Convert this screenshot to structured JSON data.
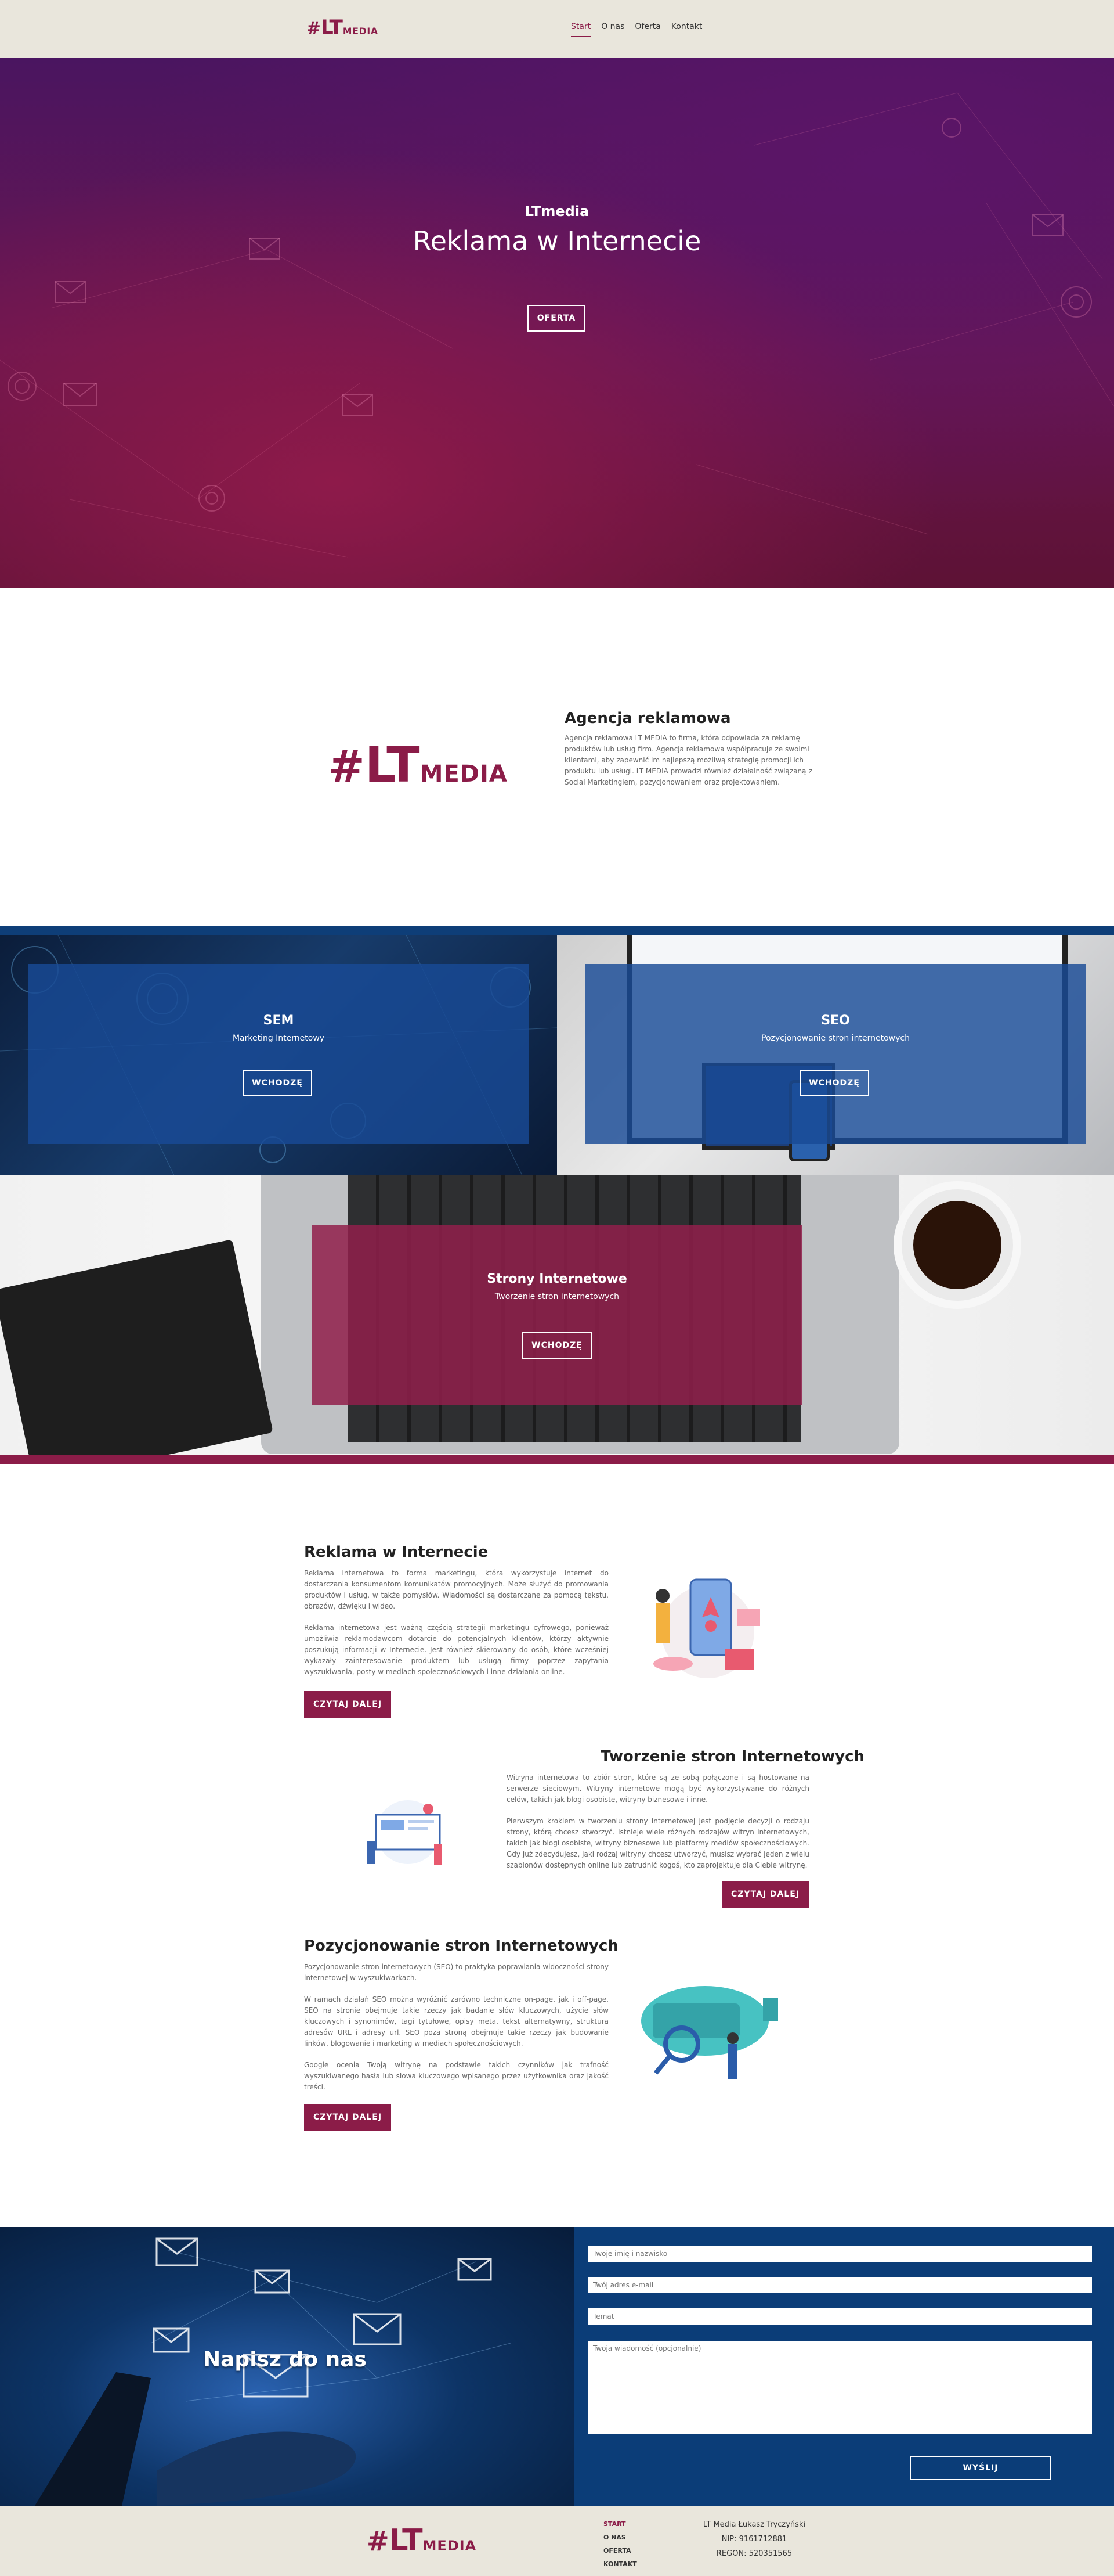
{
  "header": {
    "logo": {
      "hash": "#",
      "lt": "LT",
      "media": "MEDIA"
    },
    "nav": [
      "Start",
      "O nas",
      "Oferta",
      "Kontakt"
    ]
  },
  "hero": {
    "subtitle": "LTmedia",
    "title": "Reklama w Internecie",
    "button": "OFERTA"
  },
  "agency": {
    "title": "Agencja reklamowa",
    "text": "Agencja reklamowa LT MEDIA to firma, która odpowiada za reklamę produktów lub usług firm. Agencja reklamowa współpracuje ze swoimi klientami, aby zapewnić im najlepszą możliwą strategię promocji ich produktu lub usługi. LT MEDIA prowadzi również działalność związaną z Social Marketingiem, pozycjonowaniem oraz projektowaniem."
  },
  "services": [
    {
      "title": "SEM",
      "subtitle": "Marketing Internetowy",
      "button": "WCHODZĘ"
    },
    {
      "title": "SEO",
      "subtitle": "Pozycjonowanie stron internetowych",
      "button": "WCHODZĘ"
    },
    {
      "title": "Strony Internetowe",
      "subtitle": "Tworzenie stron internetowych",
      "button": "WCHODZĘ"
    }
  ],
  "sections": [
    {
      "title": "Reklama w Internecie",
      "paragraphs": [
        "Reklama internetowa to forma marketingu, która wykorzystuje internet do dostarczania konsumentom komunikatów promocyjnych. Może służyć do promowania produktów i usług, w także pomysłów. Wiadomości są dostarczane za pomocą tekstu, obrazów, dźwięku i wideo.",
        "Reklama internetowa jest ważną częścią strategii marketingu cyfrowego, ponieważ umożliwia reklamodawcom dotarcie do potencjalnych klientów, którzy aktywnie poszukują informacji w Internecie. Jest również skierowany do osób, które wcześniej wykazały zainteresowanie produktem lub usługą firmy poprzez zapytania wyszukiwania, posty w mediach społecznościowych i inne działania online."
      ],
      "button": "CZYTAJ DALEJ"
    },
    {
      "title": "Tworzenie stron Internetowych",
      "paragraphs": [
        "Witryna internetowa to zbiór stron, które są ze sobą połączone i są hostowane na serwerze sieciowym. Witryny internetowe mogą być wykorzystywane do różnych celów, takich jak blogi osobiste, witryny biznesowe i inne.",
        "Pierwszym krokiem w tworzeniu strony internetowej jest podjęcie decyzji o rodzaju strony, którą chcesz stworzyć. Istnieje wiele różnych rodzajów witryn internetowych, takich jak blogi osobiste, witryny biznesowe lub platformy mediów społecznościowych. Gdy już zdecydujesz, jaki rodzaj witryny chcesz utworzyć, musisz wybrać jeden z wielu szablonów dostępnych online lub zatrudnić kogoś, kto zaprojektuje dla Ciebie witrynę."
      ],
      "button": "CZYTAJ DALEJ"
    },
    {
      "title": "Pozycjonowanie stron Internetowych",
      "paragraphs": [
        "Pozycjonowanie stron internetowych (SEO) to praktyka poprawiania widoczności strony internetowej w wyszukiwarkach.",
        "W ramach działań SEO można wyróżnić zarówno techniczne on-page, jak i off-page. SEO na stronie obejmuje takie rzeczy jak badanie słów kluczowych, użycie słów kluczowych i synonimów, tagi tytułowe, opisy meta, tekst alternatywny, struktura adresów URL i adresy url. SEO poza stroną obejmuje takie rzeczy jak budowanie linków, blogowanie i marketing w mediach społecznościowych.",
        "Google ocenia Twoją witrynę na podstawie takich czynników jak trafność wyszukiwanego hasła lub słowa kluczowego wpisanego przez użytkownika oraz jakość treści."
      ],
      "button": "CZYTAJ DALEJ"
    }
  ],
  "contact": {
    "title": "Napisz do nas",
    "name_placeholder": "Twoje imię i nazwisko",
    "email_placeholder": "Twój adres e-mail",
    "subject_placeholder": "Temat",
    "message_placeholder": "Twoja wiadomość (opcjonalnie)",
    "button": "WYŚLIJ"
  },
  "footer": {
    "nav": [
      "START",
      "O NAS",
      "OFERTA",
      "KONTAKT"
    ],
    "company": "LT Media Łukasz Tryczyński",
    "nip": "NIP: 9161712881",
    "regon": "REGON: 520351565"
  }
}
